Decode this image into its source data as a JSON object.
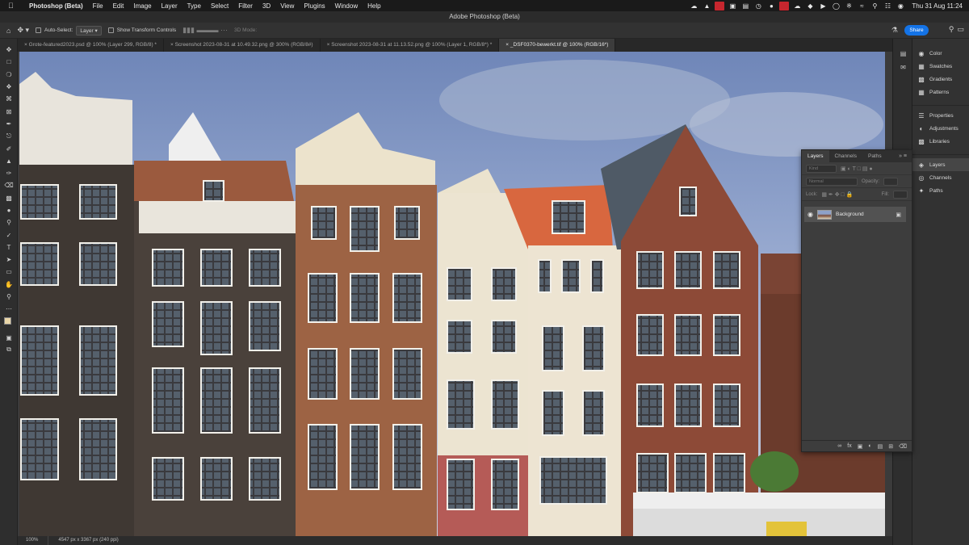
{
  "mac_menubar": {
    "app_name": "Photoshop (Beta)",
    "menus": [
      "File",
      "Edit",
      "Image",
      "Layer",
      "Type",
      "Select",
      "Filter",
      "3D",
      "View",
      "Plugins",
      "Window",
      "Help"
    ],
    "clock": "Thu 31 Aug  11:24"
  },
  "window_title": "Adobe Photoshop (Beta)",
  "options_bar": {
    "auto_select_label": "Auto-Select:",
    "auto_select_value": "Layer",
    "transform_controls_label": "Show Transform Controls",
    "mode_label": "3D Mode:",
    "share_label": "Share"
  },
  "tabs": [
    {
      "label": "Grote-featured2023.psd @ 100% (Layer 299, RGB/8) *"
    },
    {
      "label": "Screenshot 2023-08-31 at 10.49.32.png @ 300% (RGB/8#)"
    },
    {
      "label": "Screenshot 2023-08-31 at 11.13.52.png @ 100% (Layer 1, RGB/8*) *"
    },
    {
      "label": "_DSF0370-bewerkt.tif @ 100% (RGB/16*)"
    }
  ],
  "active_tab_index": 3,
  "status_bar": {
    "zoom": "100%",
    "doc_info": "4547 px x 3367 px (240 ppi)"
  },
  "right_panel": {
    "group1": [
      "Color",
      "Swatches",
      "Gradients",
      "Patterns"
    ],
    "group2": [
      "Properties",
      "Adjustments",
      "Libraries"
    ],
    "group3": [
      "Layers",
      "Channels",
      "Paths"
    ]
  },
  "layers_panel": {
    "tabs": [
      "Layers",
      "Channels",
      "Paths"
    ],
    "kind_placeholder": "Kind",
    "blend_mode": "Normal",
    "opacity_label": "Opacity:",
    "lock_label": "Lock:",
    "fill_label": "Fill:",
    "layers": [
      {
        "name": "Background",
        "visible": true,
        "locked": true
      }
    ]
  },
  "colors": {
    "foreground": "#e9d6a8",
    "background": "#ffffff",
    "accent": "#1473e6"
  }
}
